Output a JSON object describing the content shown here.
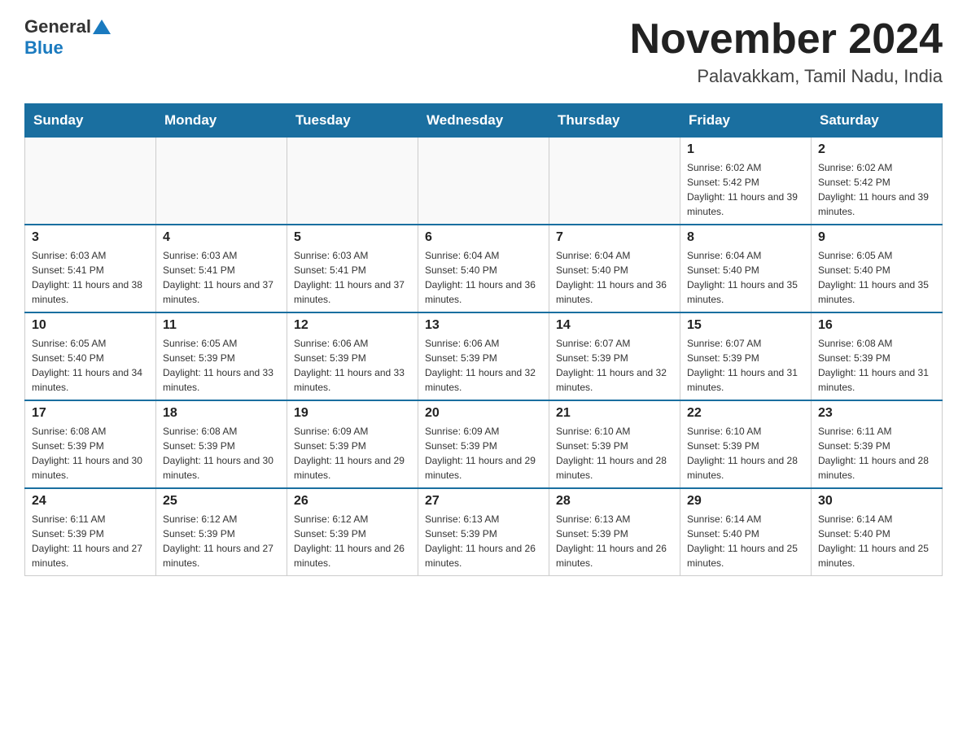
{
  "header": {
    "logo": {
      "text1": "General",
      "text2": "Blue"
    },
    "title": "November 2024",
    "location": "Palavakkam, Tamil Nadu, India"
  },
  "weekdays": [
    "Sunday",
    "Monday",
    "Tuesday",
    "Wednesday",
    "Thursday",
    "Friday",
    "Saturday"
  ],
  "weeks": [
    [
      {
        "day": "",
        "info": ""
      },
      {
        "day": "",
        "info": ""
      },
      {
        "day": "",
        "info": ""
      },
      {
        "day": "",
        "info": ""
      },
      {
        "day": "",
        "info": ""
      },
      {
        "day": "1",
        "info": "Sunrise: 6:02 AM\nSunset: 5:42 PM\nDaylight: 11 hours and 39 minutes."
      },
      {
        "day": "2",
        "info": "Sunrise: 6:02 AM\nSunset: 5:42 PM\nDaylight: 11 hours and 39 minutes."
      }
    ],
    [
      {
        "day": "3",
        "info": "Sunrise: 6:03 AM\nSunset: 5:41 PM\nDaylight: 11 hours and 38 minutes."
      },
      {
        "day": "4",
        "info": "Sunrise: 6:03 AM\nSunset: 5:41 PM\nDaylight: 11 hours and 37 minutes."
      },
      {
        "day": "5",
        "info": "Sunrise: 6:03 AM\nSunset: 5:41 PM\nDaylight: 11 hours and 37 minutes."
      },
      {
        "day": "6",
        "info": "Sunrise: 6:04 AM\nSunset: 5:40 PM\nDaylight: 11 hours and 36 minutes."
      },
      {
        "day": "7",
        "info": "Sunrise: 6:04 AM\nSunset: 5:40 PM\nDaylight: 11 hours and 36 minutes."
      },
      {
        "day": "8",
        "info": "Sunrise: 6:04 AM\nSunset: 5:40 PM\nDaylight: 11 hours and 35 minutes."
      },
      {
        "day": "9",
        "info": "Sunrise: 6:05 AM\nSunset: 5:40 PM\nDaylight: 11 hours and 35 minutes."
      }
    ],
    [
      {
        "day": "10",
        "info": "Sunrise: 6:05 AM\nSunset: 5:40 PM\nDaylight: 11 hours and 34 minutes."
      },
      {
        "day": "11",
        "info": "Sunrise: 6:05 AM\nSunset: 5:39 PM\nDaylight: 11 hours and 33 minutes."
      },
      {
        "day": "12",
        "info": "Sunrise: 6:06 AM\nSunset: 5:39 PM\nDaylight: 11 hours and 33 minutes."
      },
      {
        "day": "13",
        "info": "Sunrise: 6:06 AM\nSunset: 5:39 PM\nDaylight: 11 hours and 32 minutes."
      },
      {
        "day": "14",
        "info": "Sunrise: 6:07 AM\nSunset: 5:39 PM\nDaylight: 11 hours and 32 minutes."
      },
      {
        "day": "15",
        "info": "Sunrise: 6:07 AM\nSunset: 5:39 PM\nDaylight: 11 hours and 31 minutes."
      },
      {
        "day": "16",
        "info": "Sunrise: 6:08 AM\nSunset: 5:39 PM\nDaylight: 11 hours and 31 minutes."
      }
    ],
    [
      {
        "day": "17",
        "info": "Sunrise: 6:08 AM\nSunset: 5:39 PM\nDaylight: 11 hours and 30 minutes."
      },
      {
        "day": "18",
        "info": "Sunrise: 6:08 AM\nSunset: 5:39 PM\nDaylight: 11 hours and 30 minutes."
      },
      {
        "day": "19",
        "info": "Sunrise: 6:09 AM\nSunset: 5:39 PM\nDaylight: 11 hours and 29 minutes."
      },
      {
        "day": "20",
        "info": "Sunrise: 6:09 AM\nSunset: 5:39 PM\nDaylight: 11 hours and 29 minutes."
      },
      {
        "day": "21",
        "info": "Sunrise: 6:10 AM\nSunset: 5:39 PM\nDaylight: 11 hours and 28 minutes."
      },
      {
        "day": "22",
        "info": "Sunrise: 6:10 AM\nSunset: 5:39 PM\nDaylight: 11 hours and 28 minutes."
      },
      {
        "day": "23",
        "info": "Sunrise: 6:11 AM\nSunset: 5:39 PM\nDaylight: 11 hours and 28 minutes."
      }
    ],
    [
      {
        "day": "24",
        "info": "Sunrise: 6:11 AM\nSunset: 5:39 PM\nDaylight: 11 hours and 27 minutes."
      },
      {
        "day": "25",
        "info": "Sunrise: 6:12 AM\nSunset: 5:39 PM\nDaylight: 11 hours and 27 minutes."
      },
      {
        "day": "26",
        "info": "Sunrise: 6:12 AM\nSunset: 5:39 PM\nDaylight: 11 hours and 26 minutes."
      },
      {
        "day": "27",
        "info": "Sunrise: 6:13 AM\nSunset: 5:39 PM\nDaylight: 11 hours and 26 minutes."
      },
      {
        "day": "28",
        "info": "Sunrise: 6:13 AM\nSunset: 5:39 PM\nDaylight: 11 hours and 26 minutes."
      },
      {
        "day": "29",
        "info": "Sunrise: 6:14 AM\nSunset: 5:40 PM\nDaylight: 11 hours and 25 minutes."
      },
      {
        "day": "30",
        "info": "Sunrise: 6:14 AM\nSunset: 5:40 PM\nDaylight: 11 hours and 25 minutes."
      }
    ]
  ]
}
